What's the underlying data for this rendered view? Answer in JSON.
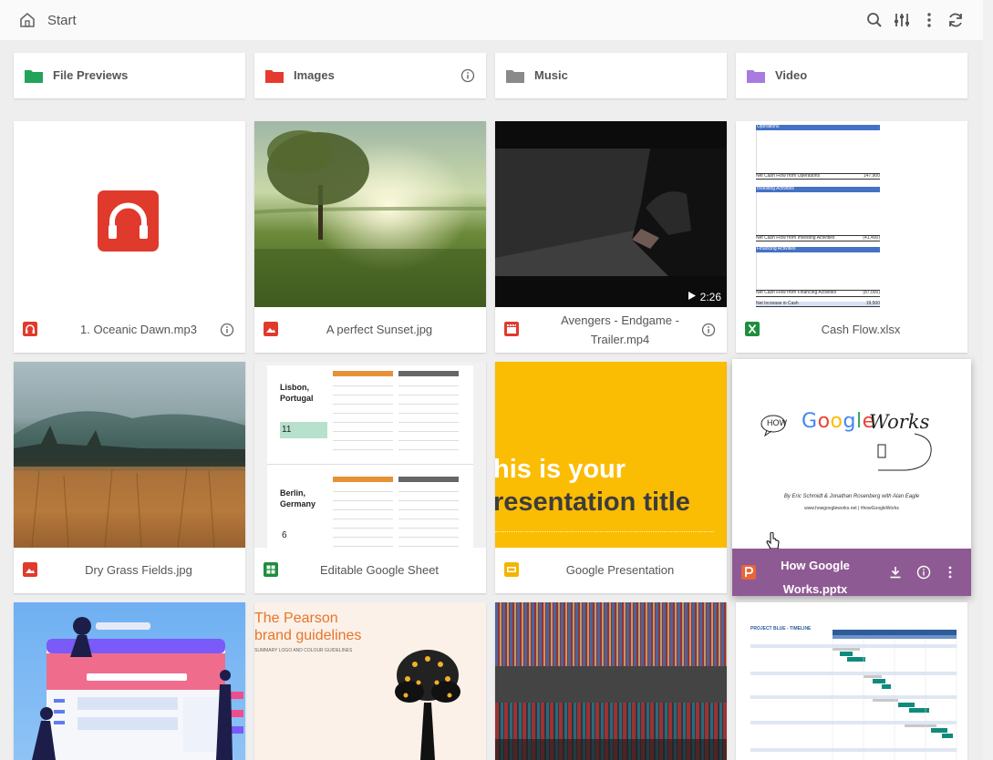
{
  "header": {
    "breadcrumb": "Start",
    "actions": [
      "search-icon",
      "filter-sliders-icon",
      "more-vertical-icon",
      "refresh-icon"
    ]
  },
  "folders": [
    {
      "label": "File Previews",
      "icon": "folder-icon",
      "color": "#22a35a",
      "has_info": false
    },
    {
      "label": "Images",
      "icon": "folder-icon",
      "color": "#e53b2e",
      "has_info": true
    },
    {
      "label": "Music",
      "icon": "folder-icon",
      "color": "#8a8a8a",
      "has_info": false
    },
    {
      "label": "Video",
      "icon": "folder-icon",
      "color": "#a77be0",
      "has_info": false
    }
  ],
  "files": [
    {
      "name": "1. Oceanic Dawn.mp3",
      "type": "audio",
      "icon": "headphones-icon",
      "color": "#e03a2c",
      "has_info": true
    },
    {
      "name": "A perfect Sunset.jpg",
      "type": "image",
      "icon": "image-icon",
      "color": "#e03a2c",
      "has_info": false
    },
    {
      "name": "Avengers - Endgame - Trailer.mp4",
      "type": "video",
      "icon": "film-icon",
      "color": "#e03a2c",
      "has_info": true,
      "duration": "2:26"
    },
    {
      "name": "Cash Flow.xlsx",
      "type": "spreadsheet",
      "icon": "excel-icon",
      "color": "#1e8e3e",
      "has_info": false
    },
    {
      "name": "Dry Grass Fields.jpg",
      "type": "image",
      "icon": "image-icon",
      "color": "#e03a2c",
      "has_info": false
    },
    {
      "name": "Editable Google Sheet",
      "type": "sheet",
      "icon": "google-sheets-icon",
      "color": "#1e8e3e",
      "has_info": false
    },
    {
      "name": "Google Presentation",
      "type": "slides",
      "icon": "google-slides-icon",
      "color": "#f4b400",
      "has_info": false
    },
    {
      "name": "How Google Works.pptx",
      "type": "powerpoint",
      "icon": "powerpoint-icon",
      "color": "#e8653a",
      "has_info": true,
      "active": true
    },
    {
      "name": "",
      "type": "illustration",
      "icon": "",
      "color": "",
      "has_info": false
    },
    {
      "name": "",
      "type": "document",
      "icon": "",
      "color": "",
      "has_info": false
    },
    {
      "name": "",
      "type": "image",
      "icon": "",
      "color": "",
      "has_info": false
    },
    {
      "name": "",
      "type": "spreadsheet",
      "icon": "",
      "color": "",
      "has_info": false
    }
  ],
  "thumbs": {
    "sheet": {
      "city1": "Lisbon, Portugal",
      "value1": "11",
      "city2": "Berlin, Germany",
      "value2": "6"
    },
    "slides": {
      "line1": "his is your",
      "line2": "resentation title"
    },
    "pptx": {
      "how": "HOW",
      "title_google": "Google",
      "title_works": "Works",
      "authors": "By Eric Schmidt & Jonathan Rosenberg with Alan Eagle",
      "url": "www.howgoogleworks.net | #howGoogleWorks"
    },
    "pearson": {
      "title_line1": "The Pearson",
      "title_line2": "brand guidelines",
      "subtitle": "SUMMARY LOGO AND COLOUR GUIDELINES"
    },
    "timeline": {
      "title": "PROJECT BLUE - TIMELINE"
    },
    "cashflow": {
      "section1": "Operations",
      "total1_label": "Net Cash Flow from Operations",
      "total1_value": "147,900",
      "section2": "Investing Activities",
      "total2_label": "Net Cash Flow from Investing Activities",
      "total2_value": "(41,400)",
      "section3": "Financing Activities",
      "total3_label": "Net Cash Flow from Financing Activities",
      "total3_value": "(87,000)",
      "final_label": "Net Increase in Cash",
      "final_value": "19,500"
    }
  }
}
